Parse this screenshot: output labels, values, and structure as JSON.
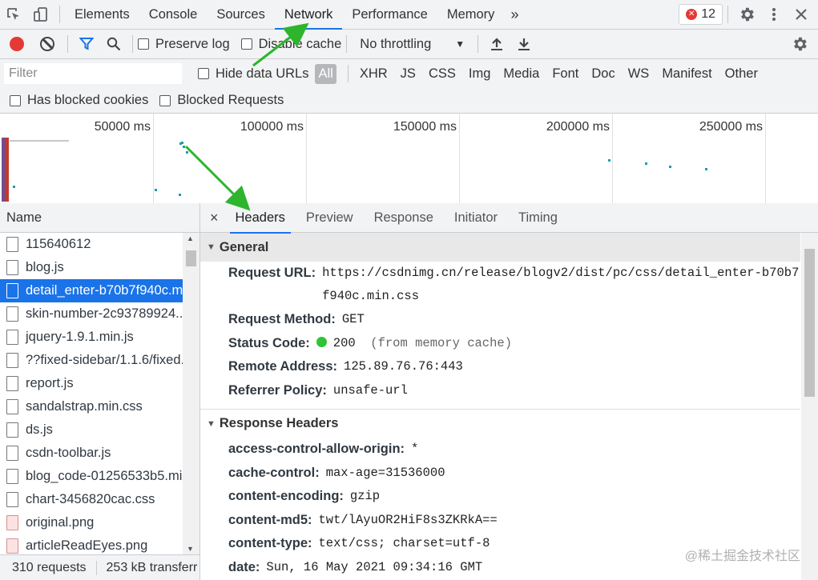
{
  "tabs": [
    "Elements",
    "Console",
    "Sources",
    "Network",
    "Performance",
    "Memory"
  ],
  "active_tab": "Network",
  "more_tabs": "»",
  "error_count": "12",
  "toolbar": {
    "preserve_log": "Preserve log",
    "disable_cache": "Disable cache",
    "throttling": "No throttling"
  },
  "filter": {
    "placeholder": "Filter",
    "hide_data_urls": "Hide data URLs",
    "types": [
      "All",
      "XHR",
      "JS",
      "CSS",
      "Img",
      "Media",
      "Font",
      "Doc",
      "WS",
      "Manifest",
      "Other"
    ],
    "has_blocked_cookies": "Has blocked cookies",
    "blocked_requests": "Blocked Requests"
  },
  "overview": {
    "ticks": [
      "50000 ms",
      "100000 ms",
      "150000 ms",
      "200000 ms",
      "250000 ms"
    ]
  },
  "requests": {
    "header": "Name",
    "items": [
      "115640612",
      "blog.js",
      "detail_enter-b70b7f940c.m",
      "skin-number-2c93789924..",
      "jquery-1.9.1.min.js",
      "??fixed-sidebar/1.1.6/fixed.",
      "report.js",
      "sandalstrap.min.css",
      "ds.js",
      "csdn-toolbar.js",
      "blog_code-01256533b5.mi",
      "chart-3456820cac.css",
      "original.png",
      "articleReadEyes.png"
    ],
    "selected_index": 2,
    "status_requests": "310 requests",
    "status_transferred": "253 kB transferr"
  },
  "detail": {
    "close": "×",
    "tabs": [
      "Headers",
      "Preview",
      "Response",
      "Initiator",
      "Timing"
    ],
    "active": "Headers",
    "general": {
      "title": "General",
      "request_url_key": "Request URL:",
      "request_url": "https://csdnimg.cn/release/blogv2/dist/pc/css/detail_enter-b70b7f940c.min.css",
      "request_method_key": "Request Method:",
      "request_method": "GET",
      "status_code_key": "Status Code:",
      "status_code": "200",
      "status_note": "(from memory cache)",
      "remote_address_key": "Remote Address:",
      "remote_address": "125.89.76.76:443",
      "referrer_policy_key": "Referrer Policy:",
      "referrer_policy": "unsafe-url"
    },
    "response_headers": {
      "title": "Response Headers",
      "items": [
        {
          "k": "access-control-allow-origin:",
          "v": "*"
        },
        {
          "k": "cache-control:",
          "v": "max-age=31536000"
        },
        {
          "k": "content-encoding:",
          "v": "gzip"
        },
        {
          "k": "content-md5:",
          "v": "twt/lAyuOR2HiF8s3ZKRkA=="
        },
        {
          "k": "content-type:",
          "v": "text/css; charset=utf-8"
        },
        {
          "k": "date:",
          "v": "Sun, 16 May 2021 09:34:16 GMT"
        }
      ]
    }
  },
  "watermark": "@稀土掘金技术社区",
  "colors": {
    "accent": "#1a73e8",
    "record": "#e53935",
    "status_ok": "#2ec433",
    "arrow": "#2db52d"
  }
}
